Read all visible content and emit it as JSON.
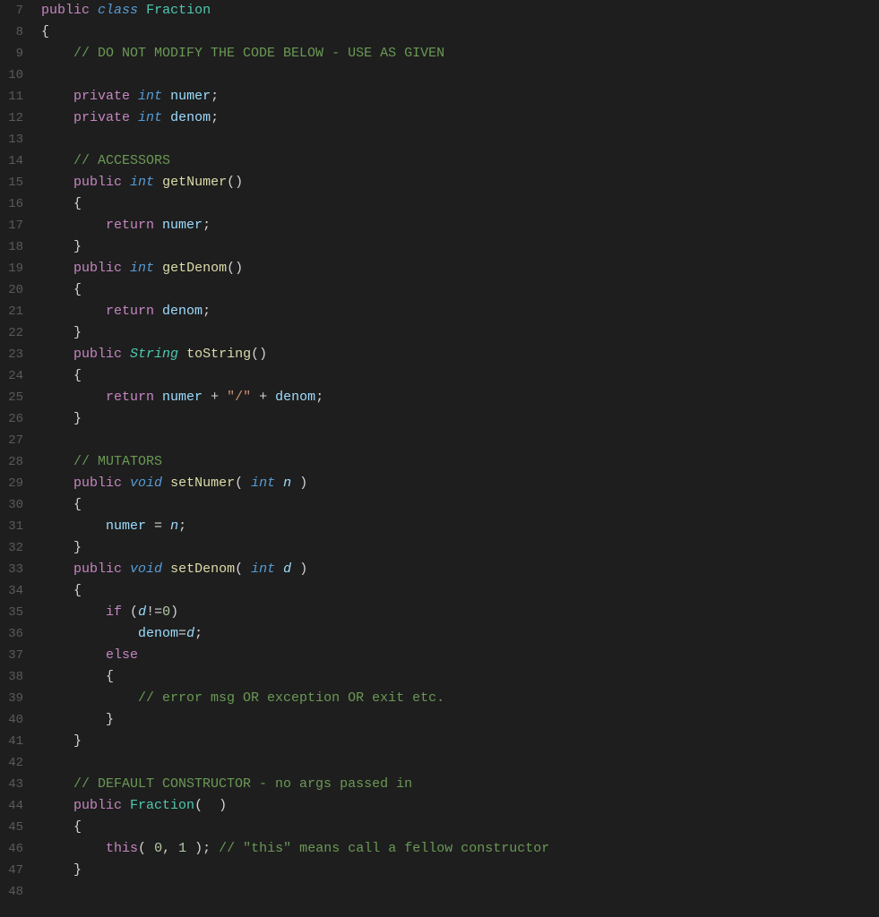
{
  "editor": {
    "background": "#1e1e1e",
    "lines": [
      {
        "num": 7,
        "tokens": [
          {
            "t": "kw-public",
            "v": "public"
          },
          {
            "t": "",
            "v": " "
          },
          {
            "t": "kw-class",
            "v": "class"
          },
          {
            "t": "",
            "v": " "
          },
          {
            "t": "class-name",
            "v": "Fraction"
          }
        ]
      },
      {
        "num": 8,
        "tokens": [
          {
            "t": "punctuation",
            "v": "{"
          }
        ]
      },
      {
        "num": 9,
        "tokens": [
          {
            "t": "",
            "v": "    "
          },
          {
            "t": "comment",
            "v": "// DO NOT MODIFY THE CODE BELOW - USE AS GIVEN"
          }
        ]
      },
      {
        "num": 10,
        "tokens": []
      },
      {
        "num": 11,
        "tokens": [
          {
            "t": "",
            "v": "    "
          },
          {
            "t": "kw-private",
            "v": "private"
          },
          {
            "t": "",
            "v": " "
          },
          {
            "t": "kw-int",
            "v": "int"
          },
          {
            "t": "",
            "v": " "
          },
          {
            "t": "var-name",
            "v": "numer"
          },
          {
            "t": "punctuation",
            "v": ";"
          }
        ]
      },
      {
        "num": 12,
        "tokens": [
          {
            "t": "",
            "v": "    "
          },
          {
            "t": "kw-private",
            "v": "private"
          },
          {
            "t": "",
            "v": " "
          },
          {
            "t": "kw-int",
            "v": "int"
          },
          {
            "t": "",
            "v": " "
          },
          {
            "t": "var-name",
            "v": "denom"
          },
          {
            "t": "punctuation",
            "v": ";"
          }
        ]
      },
      {
        "num": 13,
        "tokens": []
      },
      {
        "num": 14,
        "tokens": [
          {
            "t": "",
            "v": "    "
          },
          {
            "t": "comment",
            "v": "// ACCESSORS"
          }
        ]
      },
      {
        "num": 15,
        "tokens": [
          {
            "t": "",
            "v": "    "
          },
          {
            "t": "kw-public",
            "v": "public"
          },
          {
            "t": "",
            "v": " "
          },
          {
            "t": "kw-int",
            "v": "int"
          },
          {
            "t": "",
            "v": " "
          },
          {
            "t": "method-name",
            "v": "getNumer"
          },
          {
            "t": "punctuation",
            "v": "()"
          }
        ]
      },
      {
        "num": 16,
        "tokens": [
          {
            "t": "",
            "v": "    "
          },
          {
            "t": "punctuation",
            "v": "{"
          }
        ]
      },
      {
        "num": 17,
        "tokens": [
          {
            "t": "",
            "v": "        "
          },
          {
            "t": "kw-return",
            "v": "return"
          },
          {
            "t": "",
            "v": " "
          },
          {
            "t": "var-name",
            "v": "numer"
          },
          {
            "t": "punctuation",
            "v": ";"
          }
        ]
      },
      {
        "num": 18,
        "tokens": [
          {
            "t": "",
            "v": "    "
          },
          {
            "t": "punctuation",
            "v": "}"
          }
        ]
      },
      {
        "num": 19,
        "tokens": [
          {
            "t": "",
            "v": "    "
          },
          {
            "t": "kw-public",
            "v": "public"
          },
          {
            "t": "",
            "v": " "
          },
          {
            "t": "kw-int",
            "v": "int"
          },
          {
            "t": "",
            "v": " "
          },
          {
            "t": "method-name",
            "v": "getDenom"
          },
          {
            "t": "punctuation",
            "v": "()"
          }
        ]
      },
      {
        "num": 20,
        "tokens": [
          {
            "t": "",
            "v": "    "
          },
          {
            "t": "punctuation",
            "v": "{"
          }
        ]
      },
      {
        "num": 21,
        "tokens": [
          {
            "t": "",
            "v": "        "
          },
          {
            "t": "kw-return",
            "v": "return"
          },
          {
            "t": "",
            "v": " "
          },
          {
            "t": "var-name",
            "v": "denom"
          },
          {
            "t": "punctuation",
            "v": ";"
          }
        ]
      },
      {
        "num": 22,
        "tokens": [
          {
            "t": "",
            "v": "    "
          },
          {
            "t": "punctuation",
            "v": "}"
          }
        ]
      },
      {
        "num": 23,
        "tokens": [
          {
            "t": "",
            "v": "    "
          },
          {
            "t": "kw-public",
            "v": "public"
          },
          {
            "t": "",
            "v": " "
          },
          {
            "t": "kw-string",
            "v": "String"
          },
          {
            "t": "",
            "v": " "
          },
          {
            "t": "method-name",
            "v": "toString"
          },
          {
            "t": "punctuation",
            "v": "()"
          }
        ]
      },
      {
        "num": 24,
        "tokens": [
          {
            "t": "",
            "v": "    "
          },
          {
            "t": "punctuation",
            "v": "{"
          }
        ]
      },
      {
        "num": 25,
        "tokens": [
          {
            "t": "",
            "v": "        "
          },
          {
            "t": "kw-return",
            "v": "return"
          },
          {
            "t": "",
            "v": " "
          },
          {
            "t": "var-name",
            "v": "numer"
          },
          {
            "t": "",
            "v": " "
          },
          {
            "t": "operator",
            "v": "+"
          },
          {
            "t": "",
            "v": " "
          },
          {
            "t": "string-lit",
            "v": "\"/\""
          },
          {
            "t": "",
            "v": " "
          },
          {
            "t": "operator",
            "v": "+"
          },
          {
            "t": "",
            "v": " "
          },
          {
            "t": "var-name",
            "v": "denom"
          },
          {
            "t": "punctuation",
            "v": ";"
          }
        ]
      },
      {
        "num": 26,
        "tokens": [
          {
            "t": "",
            "v": "    "
          },
          {
            "t": "punctuation",
            "v": "}"
          }
        ]
      },
      {
        "num": 27,
        "tokens": []
      },
      {
        "num": 28,
        "tokens": [
          {
            "t": "",
            "v": "    "
          },
          {
            "t": "comment",
            "v": "// MUTATORS"
          }
        ]
      },
      {
        "num": 29,
        "tokens": [
          {
            "t": "",
            "v": "    "
          },
          {
            "t": "kw-public",
            "v": "public"
          },
          {
            "t": "",
            "v": " "
          },
          {
            "t": "kw-void",
            "v": "void"
          },
          {
            "t": "",
            "v": " "
          },
          {
            "t": "method-name",
            "v": "setNumer"
          },
          {
            "t": "punctuation",
            "v": "("
          },
          {
            "t": "",
            "v": " "
          },
          {
            "t": "kw-int",
            "v": "int"
          },
          {
            "t": "",
            "v": " "
          },
          {
            "t": "param-name",
            "v": "n"
          },
          {
            "t": "",
            "v": " "
          },
          {
            "t": "punctuation",
            "v": ")"
          }
        ]
      },
      {
        "num": 30,
        "tokens": [
          {
            "t": "",
            "v": "    "
          },
          {
            "t": "punctuation",
            "v": "{"
          }
        ]
      },
      {
        "num": 31,
        "tokens": [
          {
            "t": "",
            "v": "        "
          },
          {
            "t": "var-name",
            "v": "numer"
          },
          {
            "t": "",
            "v": " "
          },
          {
            "t": "operator",
            "v": "="
          },
          {
            "t": "",
            "v": " "
          },
          {
            "t": "param-name",
            "v": "n"
          },
          {
            "t": "punctuation",
            "v": ";"
          }
        ]
      },
      {
        "num": 32,
        "tokens": [
          {
            "t": "",
            "v": "    "
          },
          {
            "t": "punctuation",
            "v": "}"
          }
        ]
      },
      {
        "num": 33,
        "tokens": [
          {
            "t": "",
            "v": "    "
          },
          {
            "t": "kw-public",
            "v": "public"
          },
          {
            "t": "",
            "v": " "
          },
          {
            "t": "kw-void",
            "v": "void"
          },
          {
            "t": "",
            "v": " "
          },
          {
            "t": "method-name",
            "v": "setDenom"
          },
          {
            "t": "punctuation",
            "v": "("
          },
          {
            "t": "",
            "v": " "
          },
          {
            "t": "kw-int",
            "v": "int"
          },
          {
            "t": "",
            "v": " "
          },
          {
            "t": "param-name",
            "v": "d"
          },
          {
            "t": "",
            "v": " "
          },
          {
            "t": "punctuation",
            "v": ")"
          }
        ]
      },
      {
        "num": 34,
        "tokens": [
          {
            "t": "",
            "v": "    "
          },
          {
            "t": "punctuation",
            "v": "{"
          }
        ]
      },
      {
        "num": 35,
        "tokens": [
          {
            "t": "",
            "v": "        "
          },
          {
            "t": "kw-if",
            "v": "if"
          },
          {
            "t": "",
            "v": " "
          },
          {
            "t": "punctuation",
            "v": "("
          },
          {
            "t": "param-name",
            "v": "d"
          },
          {
            "t": "operator",
            "v": "!="
          },
          {
            "t": "number-lit",
            "v": "0"
          },
          {
            "t": "punctuation",
            "v": ")"
          }
        ]
      },
      {
        "num": 36,
        "tokens": [
          {
            "t": "",
            "v": "            "
          },
          {
            "t": "var-name",
            "v": "denom"
          },
          {
            "t": "operator",
            "v": "="
          },
          {
            "t": "param-name",
            "v": "d"
          },
          {
            "t": "punctuation",
            "v": ";"
          }
        ]
      },
      {
        "num": 37,
        "tokens": [
          {
            "t": "",
            "v": "        "
          },
          {
            "t": "kw-else",
            "v": "else"
          }
        ]
      },
      {
        "num": 38,
        "tokens": [
          {
            "t": "",
            "v": "        "
          },
          {
            "t": "punctuation",
            "v": "{"
          }
        ]
      },
      {
        "num": 39,
        "tokens": [
          {
            "t": "",
            "v": "            "
          },
          {
            "t": "comment",
            "v": "// error msg OR exception OR exit etc."
          }
        ]
      },
      {
        "num": 40,
        "tokens": [
          {
            "t": "",
            "v": "        "
          },
          {
            "t": "punctuation",
            "v": "}"
          }
        ]
      },
      {
        "num": 41,
        "tokens": [
          {
            "t": "",
            "v": "    "
          },
          {
            "t": "punctuation",
            "v": "}"
          }
        ]
      },
      {
        "num": 42,
        "tokens": []
      },
      {
        "num": 43,
        "tokens": [
          {
            "t": "",
            "v": "    "
          },
          {
            "t": "comment",
            "v": "// DEFAULT CONSTRUCTOR - no args passed in"
          }
        ]
      },
      {
        "num": 44,
        "tokens": [
          {
            "t": "",
            "v": "    "
          },
          {
            "t": "kw-public",
            "v": "public"
          },
          {
            "t": "",
            "v": " "
          },
          {
            "t": "class-name",
            "v": "Fraction"
          },
          {
            "t": "punctuation",
            "v": "(  )"
          }
        ]
      },
      {
        "num": 45,
        "tokens": [
          {
            "t": "",
            "v": "    "
          },
          {
            "t": "punctuation",
            "v": "{"
          }
        ]
      },
      {
        "num": 46,
        "tokens": [
          {
            "t": "",
            "v": "        "
          },
          {
            "t": "kw-this",
            "v": "this"
          },
          {
            "t": "punctuation",
            "v": "("
          },
          {
            "t": "",
            "v": " "
          },
          {
            "t": "number-lit",
            "v": "0"
          },
          {
            "t": "punctuation",
            "v": ","
          },
          {
            "t": "",
            "v": " "
          },
          {
            "t": "number-lit",
            "v": "1"
          },
          {
            "t": "",
            "v": " "
          },
          {
            "t": "punctuation",
            "v": ");"
          },
          {
            "t": "",
            "v": " "
          },
          {
            "t": "comment",
            "v": "// \"this\" means call a fellow constructor"
          }
        ]
      },
      {
        "num": 47,
        "tokens": [
          {
            "t": "",
            "v": "    "
          },
          {
            "t": "punctuation",
            "v": "}"
          }
        ]
      },
      {
        "num": 48,
        "tokens": []
      }
    ]
  }
}
